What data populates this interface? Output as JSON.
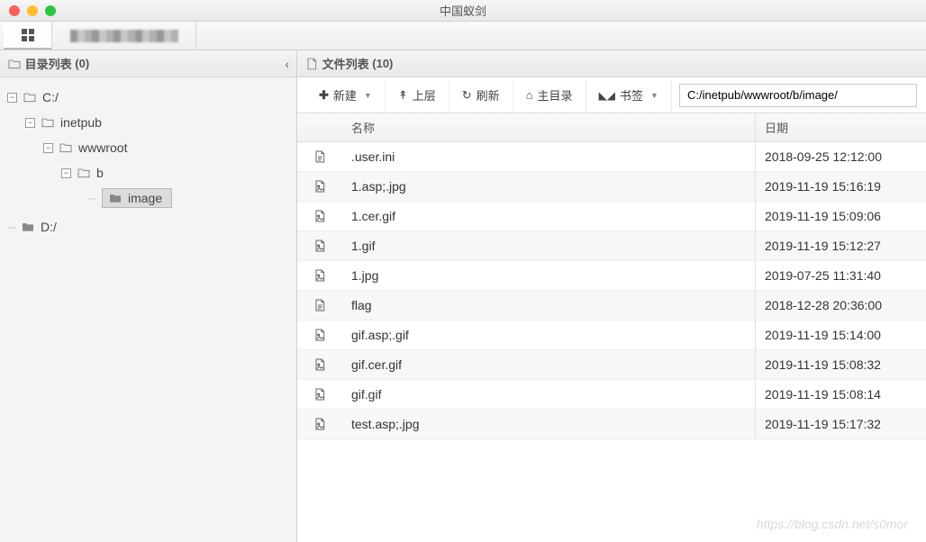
{
  "window": {
    "title": "中国蚁剑"
  },
  "sidebar": {
    "title_prefix": "目录列表",
    "count": "(0)",
    "tree": {
      "c": "C:/",
      "inetpub": "inetpub",
      "wwwroot": "wwwroot",
      "b": "b",
      "image": "image",
      "d": "D:/"
    }
  },
  "main": {
    "title_prefix": "文件列表",
    "count": "(10)"
  },
  "toolbar": {
    "new": "新建",
    "up": "上层",
    "refresh": "刷新",
    "home": "主目录",
    "bookmark": "书签",
    "path": "C:/inetpub/wwwroot/b/image/"
  },
  "columns": {
    "name": "名称",
    "date": "日期"
  },
  "files": [
    {
      "name": ".user.ini",
      "date": "2018-09-25 12:12:00",
      "type": "doc"
    },
    {
      "name": "1.asp;.jpg",
      "date": "2019-11-19 15:16:19",
      "type": "img"
    },
    {
      "name": "1.cer.gif",
      "date": "2019-11-19 15:09:06",
      "type": "img"
    },
    {
      "name": "1.gif",
      "date": "2019-11-19 15:12:27",
      "type": "img"
    },
    {
      "name": "1.jpg",
      "date": "2019-07-25 11:31:40",
      "type": "img"
    },
    {
      "name": "flag",
      "date": "2018-12-28 20:36:00",
      "type": "doc"
    },
    {
      "name": "gif.asp;.gif",
      "date": "2019-11-19 15:14:00",
      "type": "img"
    },
    {
      "name": "gif.cer.gif",
      "date": "2019-11-19 15:08:32",
      "type": "img"
    },
    {
      "name": "gif.gif",
      "date": "2019-11-19 15:08:14",
      "type": "img"
    },
    {
      "name": "test.asp;.jpg",
      "date": "2019-11-19 15:17:32",
      "type": "img"
    }
  ],
  "watermark": "https://blog.csdn.net/s0mor"
}
